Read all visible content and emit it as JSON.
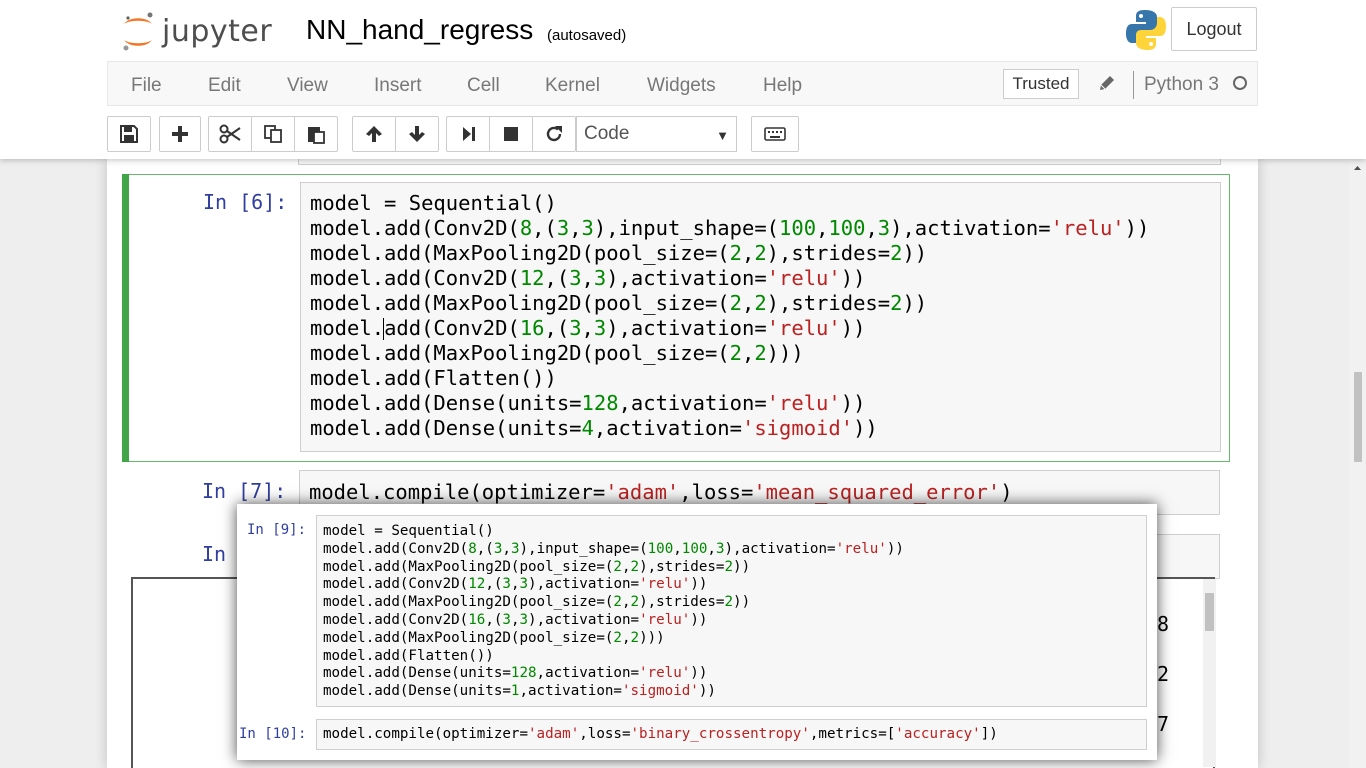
{
  "header": {
    "logo_text": "jupyter",
    "notebook_title": "NN_hand_regress",
    "autosave_status": "(autosaved)",
    "logout_label": "Logout"
  },
  "menubar": {
    "items": [
      "File",
      "Edit",
      "View",
      "Insert",
      "Cell",
      "Kernel",
      "Widgets",
      "Help"
    ],
    "trusted_label": "Trusted",
    "kernel_name": "Python 3"
  },
  "toolbar": {
    "cell_type": "Code",
    "buttons": [
      "save-icon",
      "plus-icon",
      "scissors-icon",
      "copy-icon",
      "paste-icon",
      "arrow-up-icon",
      "arrow-down-icon",
      "step-forward-icon",
      "stop-icon",
      "refresh-icon",
      "keyboard-icon"
    ]
  },
  "cells": {
    "cell6": {
      "prompt": "In [6]:",
      "lines": [
        "model = Sequential()",
        "model.add(Conv2D(8,(3,3),input_shape=(100,100,3),activation='relu'))",
        "model.add(MaxPooling2D(pool_size=(2,2),strides=2))",
        "model.add(Conv2D(12,(3,3),activation='relu'))",
        "model.add(MaxPooling2D(pool_size=(2,2),strides=2))",
        "model.add(Conv2D(16,(3,3),activation='relu'))",
        "model.add(MaxPooling2D(pool_size=(2,2)))",
        "model.add(Flatten())",
        "model.add(Dense(units=128,activation='relu'))",
        "model.add(Dense(units=4,activation='sigmoid'))"
      ]
    },
    "cell7": {
      "prompt": "In [7]:",
      "code": "model.compile(optimizer='adam',loss='mean_squared_error')"
    },
    "cell8": {
      "prompt": "In",
      "output_visible_fragments": [
        "8",
        "2",
        "7"
      ]
    }
  },
  "popup": {
    "cell9": {
      "prompt": "In [9]:",
      "lines": [
        "model = Sequential()",
        "model.add(Conv2D(8,(3,3),input_shape=(100,100,3),activation='relu'))",
        "model.add(MaxPooling2D(pool_size=(2,2),strides=2))",
        "model.add(Conv2D(12,(3,3),activation='relu'))",
        "model.add(MaxPooling2D(pool_size=(2,2),strides=2))",
        "model.add(Conv2D(16,(3,3),activation='relu'))",
        "model.add(MaxPooling2D(pool_size=(2,2)))",
        "model.add(Flatten())",
        "model.add(Dense(units=128,activation='relu'))",
        "model.add(Dense(units=1,activation='sigmoid'))"
      ]
    },
    "cell10": {
      "prompt": "In [10]:",
      "code": "model.compile(optimizer='adam',loss='binary_crossentropy',metrics=['accuracy'])"
    }
  },
  "colors": {
    "prompt": "#303f9f",
    "number": "#008800",
    "string": "#ba2121",
    "selected_cell_border": "#66bb6a",
    "selected_cell_bar": "#42a548"
  }
}
